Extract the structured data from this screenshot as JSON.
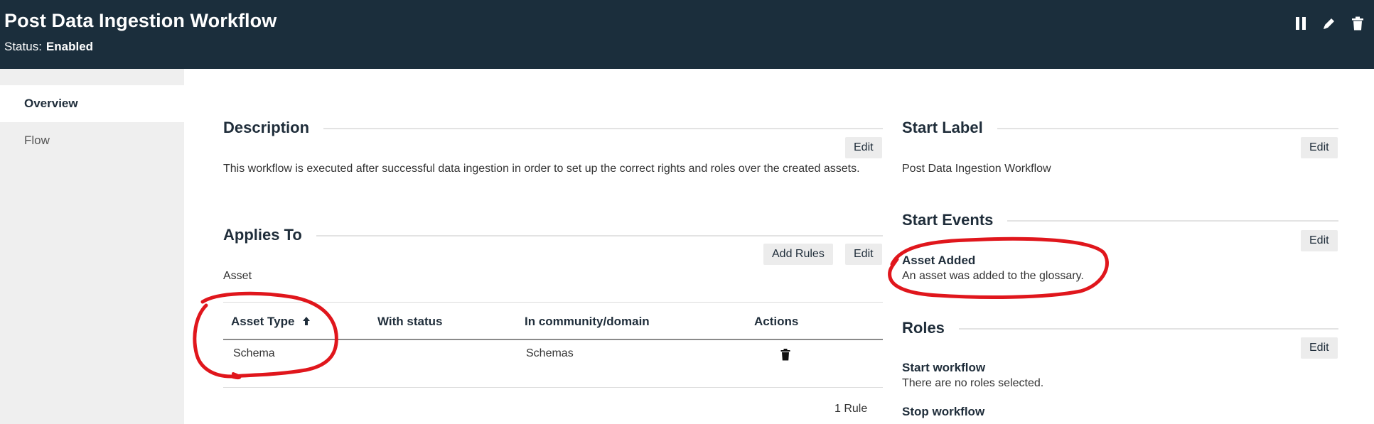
{
  "header": {
    "title": "Post Data Ingestion Workflow",
    "status_label": "Status:",
    "status_value": "Enabled",
    "icons": [
      "pause-icon",
      "pencil-icon",
      "trash-icon"
    ]
  },
  "sidebar": {
    "items": [
      {
        "label": "Overview",
        "active": true
      },
      {
        "label": "Flow",
        "active": false
      }
    ]
  },
  "description": {
    "title": "Description",
    "edit_label": "Edit",
    "text": "This workflow is executed after successful data ingestion in order to set up the correct rights and roles over the created assets."
  },
  "applies_to": {
    "title": "Applies To",
    "add_rules_label": "Add Rules",
    "edit_label": "Edit",
    "asset_label": "Asset",
    "columns": [
      "Asset Type",
      "With status",
      "In community/domain",
      "Actions"
    ],
    "rows": [
      {
        "asset_type": "Schema",
        "with_status": "",
        "community_domain": "Schemas"
      }
    ],
    "rule_count": "1 Rule"
  },
  "start_label": {
    "title": "Start Label",
    "edit_label": "Edit",
    "value": "Post Data Ingestion Workflow"
  },
  "start_events": {
    "title": "Start Events",
    "edit_label": "Edit",
    "event_name": "Asset Added",
    "event_description": "An asset was added to the glossary."
  },
  "roles": {
    "title": "Roles",
    "edit_label": "Edit",
    "start_workflow_label": "Start workflow",
    "start_workflow_value": "There are no roles selected.",
    "stop_workflow_label": "Stop workflow"
  },
  "colors": {
    "header_bg": "#1b2e3c",
    "sidebar_bg": "#efefef",
    "annotation": "#e0161c"
  }
}
